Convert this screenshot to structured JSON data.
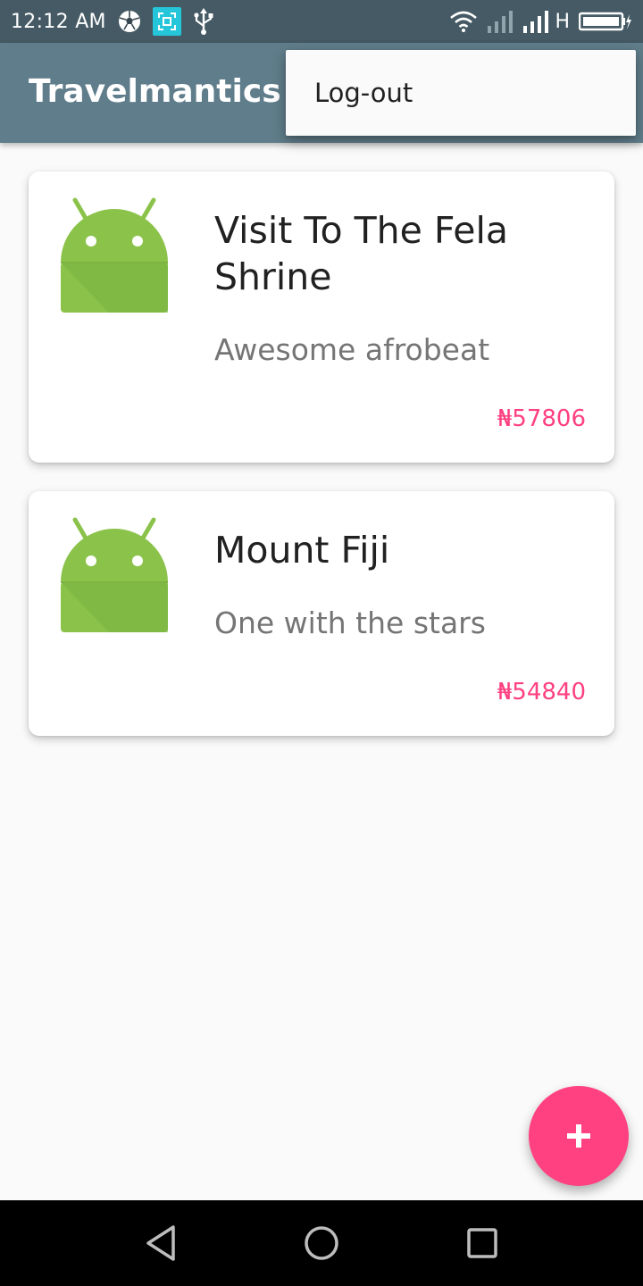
{
  "status_bar": {
    "time": "12:12 AM",
    "left_icons": [
      "soccer-ball-icon",
      "screenshot-icon",
      "usb-icon"
    ],
    "right_icons": [
      "wifi-icon",
      "signal-icon",
      "signal-icon",
      "battery-charging-icon"
    ],
    "network_type": "H"
  },
  "toolbar": {
    "title": "Travelmantics"
  },
  "overflow_menu": {
    "items": [
      {
        "label": "Log-out"
      }
    ]
  },
  "deals": [
    {
      "title": "Visit To The Fela Shrine",
      "description": "Awesome afrobeat",
      "price": "₦57806",
      "image_icon": "android-robot-icon"
    },
    {
      "title": "Mount Fiji",
      "description": "One with the stars",
      "price": "₦54840",
      "image_icon": "android-robot-icon"
    }
  ],
  "fab": {
    "icon": "plus-icon"
  },
  "navigation_bar": {
    "buttons": [
      "back-icon",
      "home-icon",
      "recents-icon"
    ]
  },
  "colors": {
    "status_bar": "#455a64",
    "toolbar": "#607d8b",
    "accent": "#ff4081",
    "android_green": "#8bc34a",
    "background": "#fafafa",
    "card": "#ffffff"
  }
}
